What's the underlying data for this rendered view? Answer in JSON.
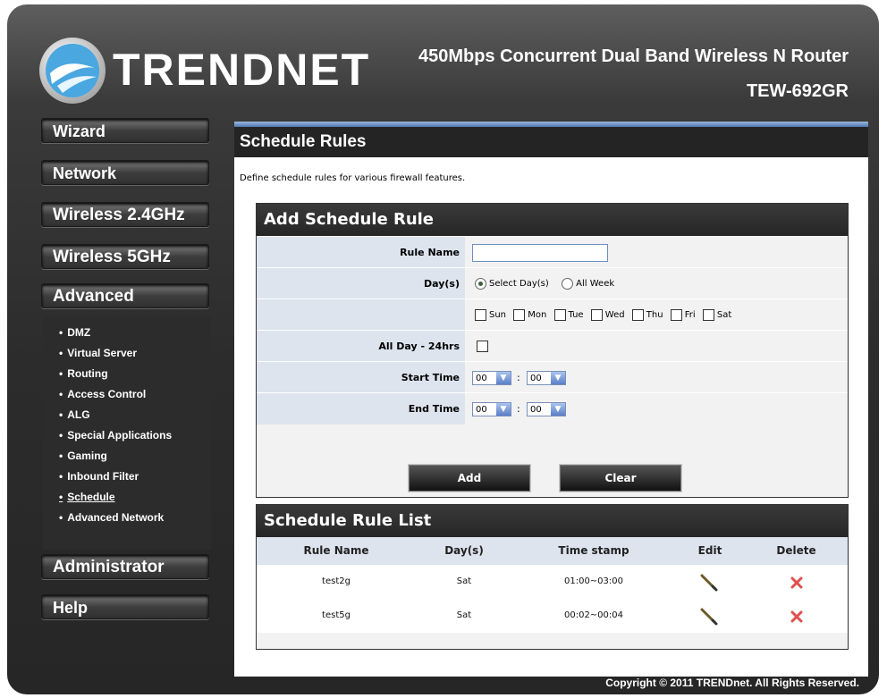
{
  "header": {
    "brand": "TRENDNET",
    "product": "450Mbps Concurrent Dual Band Wireless N Router",
    "model": "TEW-692GR"
  },
  "nav": {
    "wizard": "Wizard",
    "network": "Network",
    "wireless24": "Wireless 2.4GHz",
    "wireless5": "Wireless 5GHz",
    "advanced": "Advanced",
    "administrator": "Administrator",
    "help": "Help"
  },
  "submenu": [
    "DMZ",
    "Virtual Server",
    "Routing",
    "Access Control",
    "ALG",
    "Special Applications",
    "Gaming",
    "Inbound Filter",
    "Schedule",
    "Advanced Network"
  ],
  "page": {
    "title": "Schedule Rules",
    "description": "Define schedule rules for various firewall features."
  },
  "add_rule": {
    "title": "Add Schedule Rule",
    "rule_name_label": "Rule Name",
    "rule_name_value": "",
    "days_label": "Day(s)",
    "select_days": "Select Day(s)",
    "all_week": "All Week",
    "days": [
      "Sun",
      "Mon",
      "Tue",
      "Wed",
      "Thu",
      "Fri",
      "Sat"
    ],
    "all_day_label": "All Day - 24hrs",
    "start_time_label": "Start Time",
    "end_time_label": "End Time",
    "start_hour": "00",
    "start_min": "00",
    "end_hour": "00",
    "end_min": "00",
    "colon": ":",
    "add_button": "Add",
    "clear_button": "Clear"
  },
  "rule_list": {
    "title": "Schedule Rule List",
    "columns": [
      "Rule Name",
      "Day(s)",
      "Time stamp",
      "Edit",
      "Delete"
    ],
    "rows": [
      {
        "name": "test2g",
        "days": "Sat",
        "time": "01:00~03:00"
      },
      {
        "name": "test5g",
        "days": "Sat",
        "time": "00:02~00:04"
      }
    ]
  },
  "footer": {
    "copyright": "Copyright © 2011 TRENDnet. All Rights Reserved."
  },
  "colors": {
    "frame": "#2c2c2c",
    "accent": "#4f78b4",
    "label_bg": "#dde4ee",
    "delete_x": "#e05050"
  }
}
